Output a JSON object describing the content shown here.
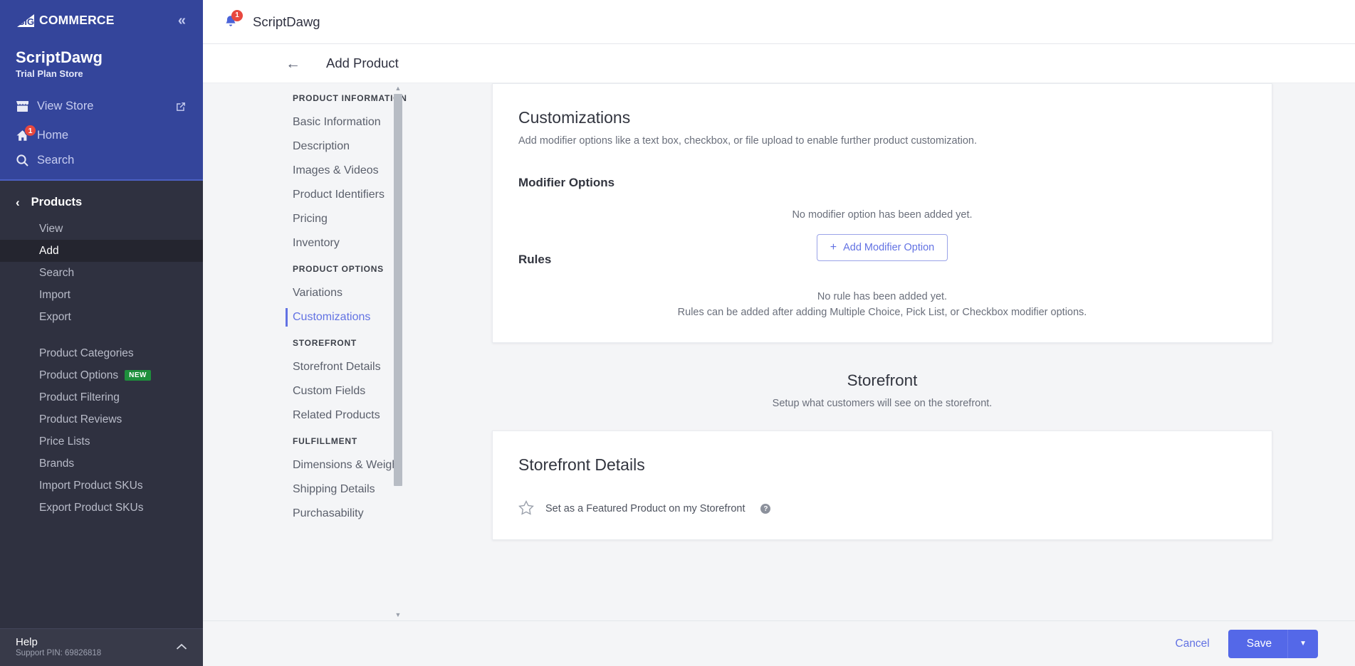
{
  "sidebar": {
    "logo_word": "COMMERCE",
    "logo_mark": "big-logo-icon",
    "collapse_icon": "«",
    "store_name": "ScriptDawg",
    "plan": "Trial Plan Store",
    "quick_links": [
      {
        "label": "View Store",
        "icon": "store-icon",
        "external": true
      },
      {
        "label": "Home",
        "icon": "home-icon",
        "badge": "1"
      },
      {
        "label": "Search",
        "icon": "search-icon"
      }
    ],
    "section_back_label": "Products",
    "items": [
      {
        "label": "View",
        "active": false
      },
      {
        "label": "Add",
        "active": true
      },
      {
        "label": "Search",
        "active": false
      },
      {
        "label": "Import",
        "active": false
      },
      {
        "label": "Export",
        "active": false
      }
    ],
    "items2": [
      {
        "label": "Product Categories",
        "tag": ""
      },
      {
        "label": "Product Options",
        "tag": "NEW"
      },
      {
        "label": "Product Filtering",
        "tag": ""
      },
      {
        "label": "Product Reviews",
        "tag": ""
      },
      {
        "label": "Price Lists",
        "tag": ""
      },
      {
        "label": "Brands",
        "tag": ""
      },
      {
        "label": "Import Product SKUs",
        "tag": ""
      },
      {
        "label": "Export Product SKUs",
        "tag": ""
      }
    ],
    "help": {
      "title": "Help",
      "pin": "Support PIN: 69826818",
      "chevron": "⌃"
    }
  },
  "topbar": {
    "bell_icon": "bell-icon",
    "bell_badge": "1",
    "title": "ScriptDawg"
  },
  "pagebar": {
    "back_icon": "←",
    "title": "Add Product"
  },
  "subnav": {
    "groups": [
      {
        "title": "PRODUCT INFORMATION",
        "items": [
          {
            "label": "Basic Information",
            "active": false
          },
          {
            "label": "Description",
            "active": false
          },
          {
            "label": "Images & Videos",
            "active": false
          },
          {
            "label": "Product Identifiers",
            "active": false
          },
          {
            "label": "Pricing",
            "active": false
          },
          {
            "label": "Inventory",
            "active": false
          }
        ]
      },
      {
        "title": "PRODUCT OPTIONS",
        "items": [
          {
            "label": "Variations",
            "active": false
          },
          {
            "label": "Customizations",
            "active": true
          }
        ]
      },
      {
        "title": "STOREFRONT",
        "items": [
          {
            "label": "Storefront Details",
            "active": false
          },
          {
            "label": "Custom Fields",
            "active": false
          },
          {
            "label": "Related Products",
            "active": false
          }
        ]
      },
      {
        "title": "FULFILLMENT",
        "items": [
          {
            "label": "Dimensions & Weight",
            "active": false
          },
          {
            "label": "Shipping Details",
            "active": false
          },
          {
            "label": "Purchasability",
            "active": false
          }
        ]
      }
    ],
    "scroll_up_icon": "▲",
    "scroll_down_icon": "▼"
  },
  "main": {
    "customizations": {
      "title": "Customizations",
      "subtitle": "Add modifier options like a text box, checkbox, or file upload to enable further product customization.",
      "modifier_heading": "Modifier Options",
      "modifier_empty": "No modifier option has been added yet.",
      "add_modifier_label": "Add Modifier Option",
      "add_modifier_plus": "+",
      "rules_heading": "Rules",
      "rules_empty_line1": "No rule has been added yet.",
      "rules_empty_line2": "Rules can be added after adding Multiple Choice, Pick List, or Checkbox modifier options."
    },
    "storefront_banner": {
      "title": "Storefront",
      "subtitle": "Setup what customers will see on the storefront."
    },
    "storefront_details": {
      "title": "Storefront Details",
      "featured_label": "Set as a Featured Product on my Storefront",
      "featured_star_icon": "star-outline-icon",
      "help_icon_glyph": "?"
    }
  },
  "footer": {
    "cancel_label": "Cancel",
    "save_label": "Save",
    "save_caret": "▼"
  },
  "colors": {
    "brand_blue": "#34459b",
    "accent": "#6272e3",
    "save_button": "#5468e8",
    "badge_red": "#e8483f",
    "new_tag_green": "#1e8f3c",
    "sidebar_dark": "#2f3140"
  }
}
